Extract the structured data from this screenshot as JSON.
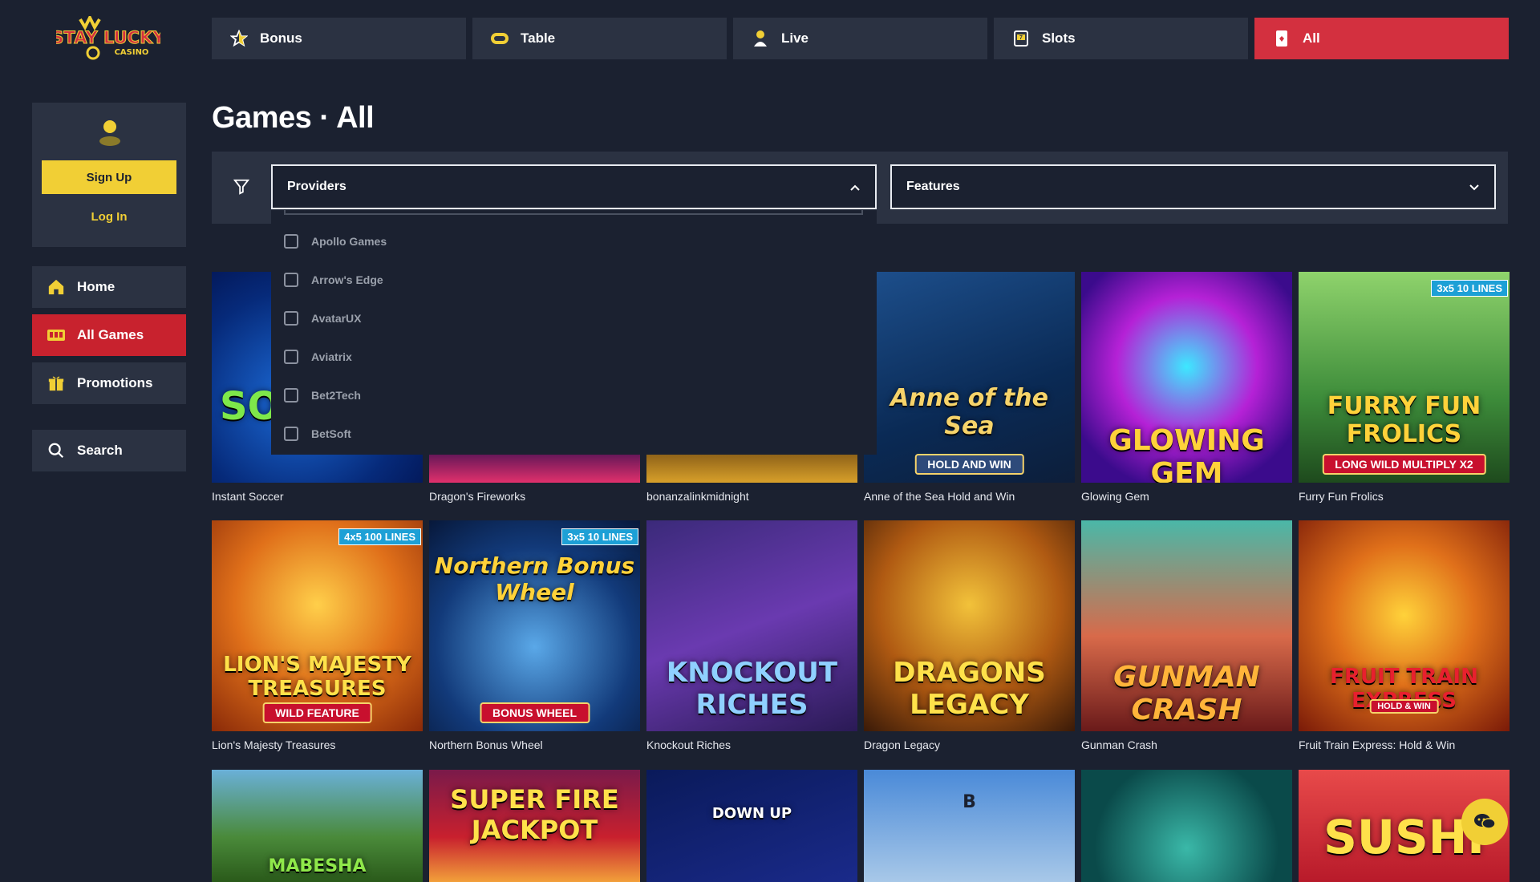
{
  "brand": {
    "logo_text": "STAY LUCKY",
    "logo_sub": "CASINO",
    "colors": {
      "bg": "#1b2130",
      "panel": "#2b3242",
      "accent": "#d3303f",
      "yellow": "#f1cf35"
    }
  },
  "topnav": [
    {
      "label": "Bonus",
      "icon": "star-icon"
    },
    {
      "label": "Table",
      "icon": "chip-icon"
    },
    {
      "label": "Live",
      "icon": "dealer-icon"
    },
    {
      "label": "Slots",
      "icon": "slot-machine-icon"
    },
    {
      "label": "All",
      "icon": "cards-icon",
      "active": true
    }
  ],
  "account": {
    "signup": "Sign Up",
    "login": "Log In"
  },
  "sidebar": [
    {
      "label": "Home",
      "icon": "home-icon"
    },
    {
      "label": "All Games",
      "icon": "all-games-icon",
      "active": true
    },
    {
      "label": "Promotions",
      "icon": "gift-icon"
    },
    {
      "label": "Search",
      "icon": "search-icon"
    }
  ],
  "page": {
    "title": "Games · All"
  },
  "filters": {
    "providers_label": "Providers",
    "features_label": "Features",
    "providers_open": true,
    "provider_options": [
      "Apollo Games",
      "Arrow's Edge",
      "AvatarUX",
      "Aviatrix",
      "Bet2Tech",
      "BetSoft"
    ]
  },
  "games": [
    {
      "name": "Instant Soccer",
      "art": "SO"
    },
    {
      "name": "Dragon's Fireworks",
      "art": ""
    },
    {
      "name": "bonanzalinkmidnight",
      "art": ""
    },
    {
      "name": "Anne of the Sea Hold and Win",
      "art": "Anne of the Sea",
      "pill": "HOLD AND WIN"
    },
    {
      "name": "Glowing Gem",
      "art": "GLOWING GEM"
    },
    {
      "name": "Furry Fun Frolics",
      "art": "FURRY FUN FROLICS",
      "badge": "3x5  10 LINES",
      "pill": "LONG WILD   MULTIPLY X2"
    },
    {
      "name": "Lion's Majesty Treasures",
      "art": "LION'S MAJESTY TREASURES",
      "badge": "4x5 100 LINES",
      "pill": "WILD FEATURE"
    },
    {
      "name": "Northern Bonus Wheel",
      "art": "Northern Bonus Wheel",
      "badge": "3x5  10 LINES",
      "pill": "BONUS WHEEL"
    },
    {
      "name": "Knockout Riches",
      "art": "KNOCKOUT RICHES"
    },
    {
      "name": "Dragon Legacy",
      "art": "DRAGONS LEGACY"
    },
    {
      "name": "Gunman Crash",
      "art": "GUNMAN CRASH"
    },
    {
      "name": "Fruit Train Express: Hold & Win",
      "art": "FRUIT TRAIN EXPRESS",
      "pill": "HOLD & WIN"
    },
    {
      "name": "",
      "art": "MABESHA"
    },
    {
      "name": "",
      "art": "SUPER FIRE JACKPOT"
    },
    {
      "name": "",
      "art": "DOWN  UP"
    },
    {
      "name": "",
      "art": "B"
    },
    {
      "name": "",
      "art": ""
    },
    {
      "name": "",
      "art": "SUSHI"
    }
  ]
}
